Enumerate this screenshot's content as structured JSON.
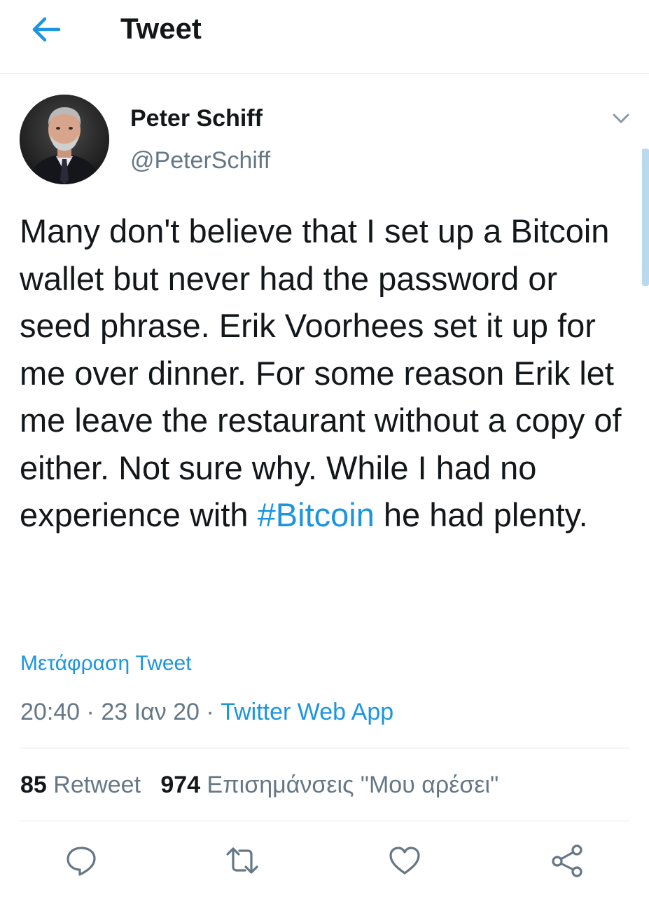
{
  "header": {
    "title": "Tweet"
  },
  "author": {
    "name": "Peter Schiff",
    "handle": "@PeterSchiff"
  },
  "tweet": {
    "text_before": "Many don't believe that I set up a Bitcoin wallet but never had the password or seed phrase. Erik Voorhees set it up for me over dinner. For some reason Erik let me leave the restaurant without a copy of either. Not sure why. While I had no experience with ",
    "hashtag": "#Bitcoin",
    "text_after": " he had plenty.",
    "translate_label": "Μετάφραση Tweet",
    "time": "20:40",
    "date": "23 Ιαν 20",
    "separator": "·",
    "source": "Twitter Web App"
  },
  "stats": {
    "retweets_count": "85",
    "retweets_label": "Retweet",
    "likes_count": "974",
    "likes_label": "Επισημάνσεις \"Μου αρέσει\""
  },
  "actions": [
    "reply-icon",
    "retweet-icon",
    "like-icon",
    "share-icon"
  ],
  "colors": {
    "accent": "#1b95e0",
    "text_primary": "#14171a",
    "text_secondary": "#657786",
    "divider": "#e1e8ed"
  }
}
